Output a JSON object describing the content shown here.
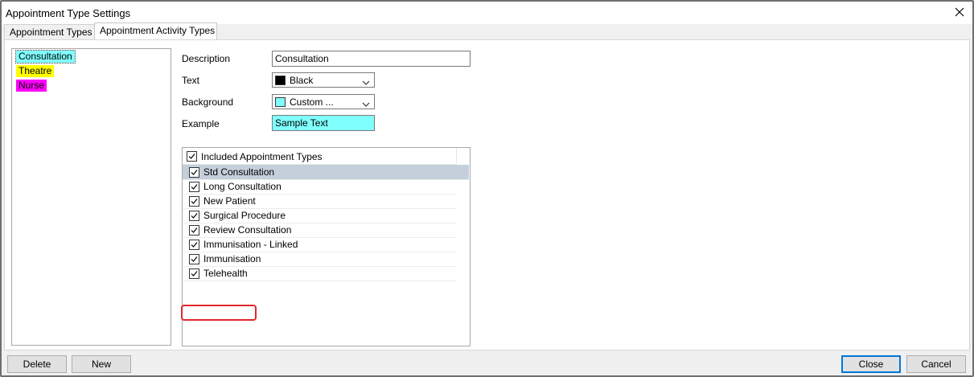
{
  "window": {
    "title": "Appointment Type Settings"
  },
  "tabs": [
    {
      "label": "Appointment Types",
      "active": false
    },
    {
      "label": "Appointment Activity Types",
      "active": true
    }
  ],
  "activity_types": [
    {
      "label": "Consultation",
      "color": "#80ffff",
      "selected": true
    },
    {
      "label": "Theatre",
      "color": "#ffff00",
      "selected": false
    },
    {
      "label": "Nurse",
      "color": "#ff00ff",
      "selected": false
    }
  ],
  "form": {
    "description_label": "Description",
    "description_value": "Consultation",
    "text_label": "Text",
    "text_value": "Black",
    "text_color": "#000000",
    "background_label": "Background",
    "background_value": "Custom ...",
    "background_color": "#80ffff",
    "example_label": "Example",
    "example_value": "Sample Text"
  },
  "included": {
    "header_label": "Included Appointment Types",
    "items": [
      {
        "label": "Std Consultation",
        "checked": true,
        "selected": true
      },
      {
        "label": "Long Consultation",
        "checked": true,
        "selected": false
      },
      {
        "label": "New Patient",
        "checked": true,
        "selected": false
      },
      {
        "label": "Surgical Procedure",
        "checked": true,
        "selected": false
      },
      {
        "label": "Review Consultation",
        "checked": true,
        "selected": false
      },
      {
        "label": "Immunisation - Linked",
        "checked": true,
        "selected": false
      },
      {
        "label": "Immunisation",
        "checked": true,
        "selected": false
      },
      {
        "label": "Telehealth",
        "checked": true,
        "selected": false,
        "highlighted": true
      }
    ]
  },
  "footer": {
    "delete_label": "Delete",
    "new_label": "New",
    "close_label": "Close",
    "cancel_label": "Cancel"
  }
}
